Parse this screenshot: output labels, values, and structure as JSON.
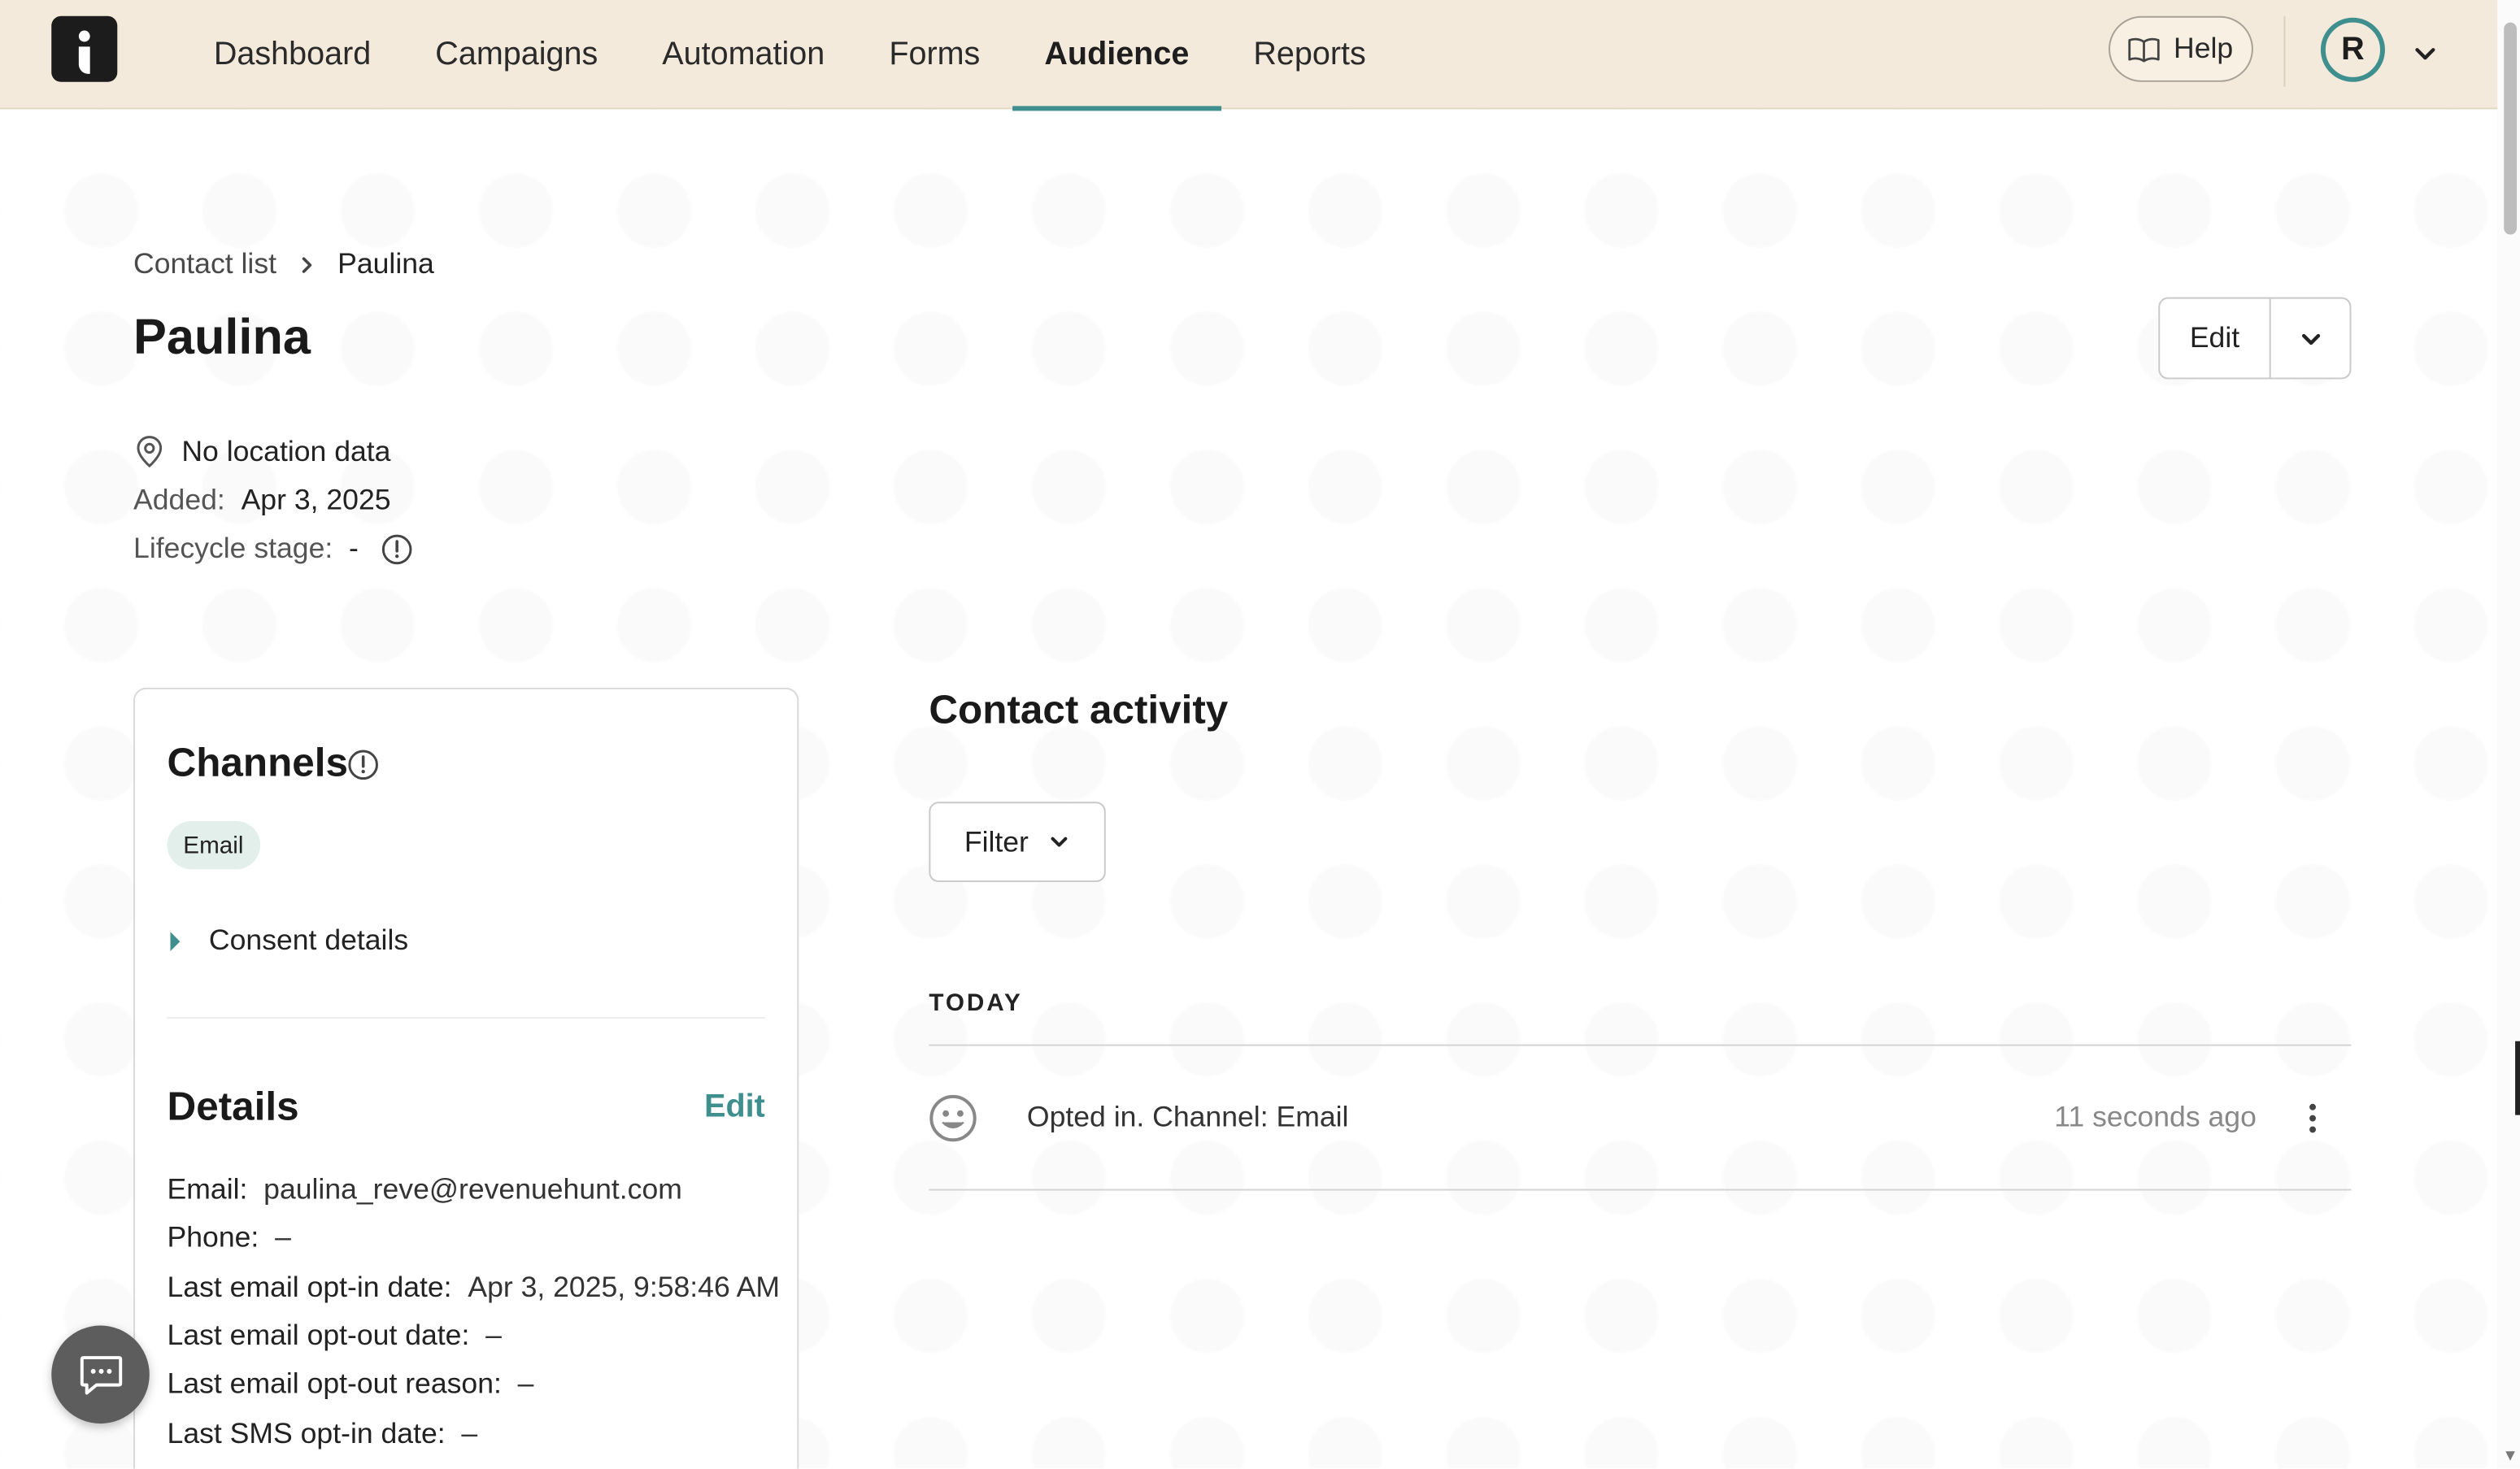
{
  "nav": {
    "items": [
      {
        "label": "Dashboard"
      },
      {
        "label": "Campaigns"
      },
      {
        "label": "Automation"
      },
      {
        "label": "Forms"
      },
      {
        "label": "Audience",
        "active": true
      },
      {
        "label": "Reports"
      }
    ],
    "help_label": "Help",
    "avatar_initial": "R",
    "accent_color": "#3f8f8f",
    "bar_color": "#f3eadb"
  },
  "breadcrumb": {
    "parent": "Contact list",
    "current": "Paulina"
  },
  "page": {
    "title": "Paulina",
    "edit_label": "Edit"
  },
  "meta": {
    "location": "No location data",
    "added_label": "Added:",
    "added_value": "Apr 3, 2025",
    "lifecycle_label": "Lifecycle stage:",
    "lifecycle_value": "-"
  },
  "channels": {
    "title": "Channels",
    "chip": "Email",
    "consent_label": "Consent details"
  },
  "details": {
    "title": "Details",
    "edit_label": "Edit",
    "rows": [
      {
        "label": "Email:",
        "value": "paulina_reve@revenuehunt.com"
      },
      {
        "label": "Phone:",
        "value": "–"
      },
      {
        "label": "Last email opt-in date:",
        "value": "Apr 3, 2025, 9:58:46 AM"
      },
      {
        "label": "Last email opt-out date:",
        "value": "–"
      },
      {
        "label": "Last email opt-out reason:",
        "value": "–"
      },
      {
        "label": "Last SMS opt-in date:",
        "value": "–"
      }
    ]
  },
  "activity": {
    "title": "Contact activity",
    "filter_label": "Filter",
    "group_label": "TODAY",
    "items": [
      {
        "text": "Opted in. Channel: Email",
        "time": "11 seconds ago",
        "icon": "smiley-icon"
      }
    ]
  }
}
